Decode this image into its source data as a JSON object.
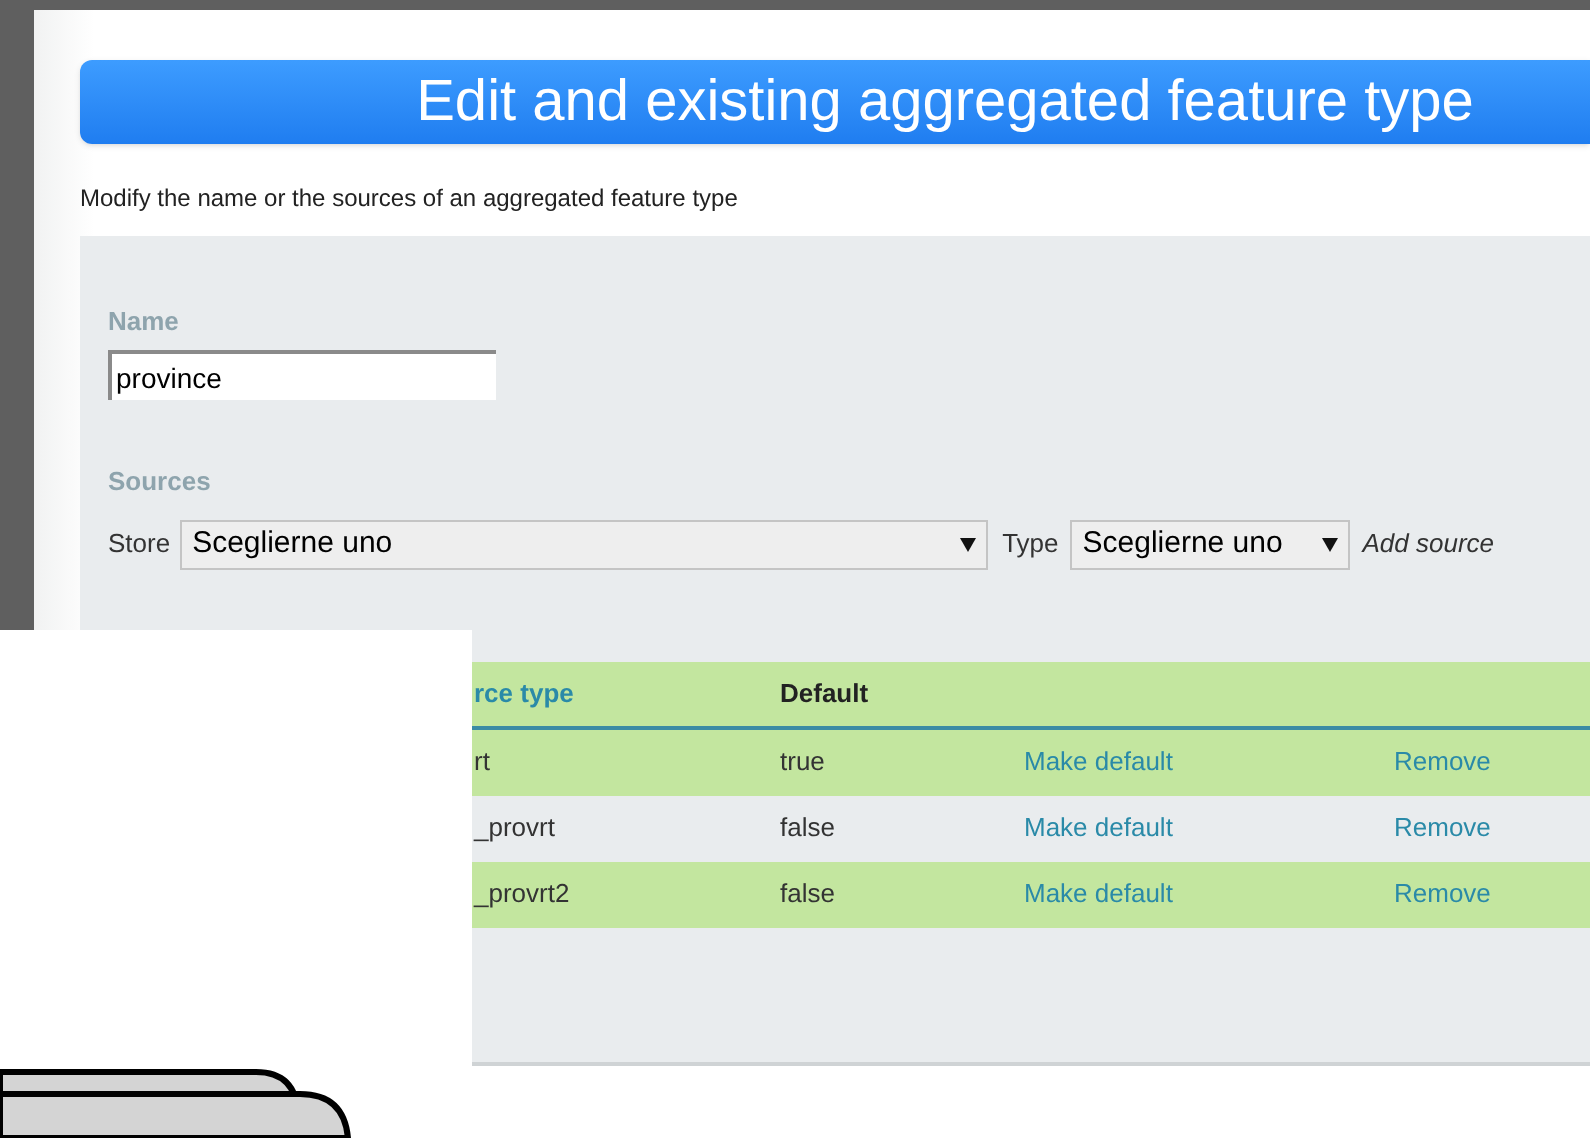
{
  "title": "Edit and existing aggregated feature type",
  "description": "Modify the name or the sources of an aggregated feature type",
  "name_field": {
    "label": "Name",
    "value": "province"
  },
  "sources": {
    "label": "Sources",
    "store_label": "Store",
    "store_value": "Sceglierne uno",
    "type_label": "Type",
    "type_value": "Sceglierne uno",
    "add_link": "Add source"
  },
  "table": {
    "columns": [
      "rce type",
      "Default"
    ],
    "rows": [
      {
        "source_type": "rt",
        "default": "true",
        "make_default": "Make default",
        "remove": "Remove"
      },
      {
        "source_type": "_provrt",
        "default": "false",
        "make_default": "Make default",
        "remove": "Remove"
      },
      {
        "source_type": "_provrt2",
        "default": "false",
        "make_default": "Make default",
        "remove": "Remove"
      }
    ]
  }
}
